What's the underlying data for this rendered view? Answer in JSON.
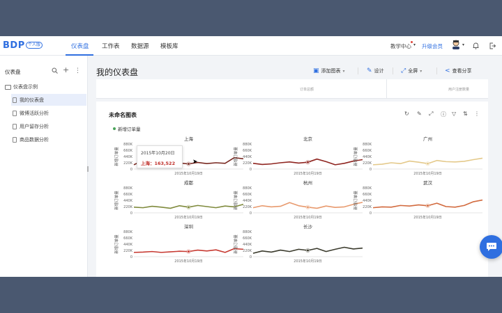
{
  "topbar": {
    "logo": "BDP",
    "logo_badge": "个人版",
    "tabs": [
      {
        "label": "仪表盘",
        "active": true
      },
      {
        "label": "工作表",
        "active": false
      },
      {
        "label": "数据源",
        "active": false
      },
      {
        "label": "模板库",
        "active": false
      }
    ],
    "teach_center": "教学中心",
    "upgrade": "升级会员"
  },
  "sidebar": {
    "title": "仪表盘",
    "root": "仪表盘示例",
    "items": [
      {
        "label": "我的仪表盘",
        "active": true
      },
      {
        "label": "微博活跃分析",
        "active": false
      },
      {
        "label": "用户留存分析",
        "active": false
      },
      {
        "label": "商品数据分析",
        "active": false
      }
    ]
  },
  "main": {
    "title": "我的仪表盘",
    "toolbar": {
      "add_chart": "添加图表",
      "design": "设计",
      "fullscreen": "全屏",
      "share": "查看分享"
    },
    "prev_card": {
      "left_text": "订单总额",
      "right_text": "用户注册数量"
    }
  },
  "card": {
    "title": "未命名图表",
    "legend": "新增订单量",
    "legend_color": "#4aa35a",
    "tooltip": {
      "date": "2015年10月20日",
      "value_line": "上海：163,522"
    }
  },
  "chart_data": {
    "type": "line",
    "title": "未命名图表",
    "ylabel": "新增订单量",
    "xlabel": "2015年10月19日",
    "yticks": [
      "880K",
      "660K",
      "440K",
      "220K",
      "0"
    ],
    "ylim": [
      0,
      880000
    ],
    "panels": [
      {
        "name": "上海",
        "color": "#7a2a22",
        "values": [
          150000,
          300000,
          200000,
          163522,
          240000,
          210000,
          180000,
          230000,
          190000,
          220000,
          200000,
          400000,
          360000
        ]
      },
      {
        "name": "北京",
        "color": "#8f2520",
        "values": [
          200000,
          160000,
          180000,
          220000,
          250000,
          210000,
          240000,
          350000,
          260000,
          150000,
          200000,
          280000,
          330000
        ]
      },
      {
        "name": "广州",
        "color": "#e4c98a",
        "values": [
          150000,
          170000,
          220000,
          190000,
          280000,
          240000,
          190000,
          300000,
          260000,
          250000,
          270000,
          330000,
          380000
        ]
      },
      {
        "name": "成都",
        "color": "#7f8a3c",
        "values": [
          200000,
          180000,
          230000,
          200000,
          160000,
          250000,
          200000,
          260000,
          220000,
          180000,
          240000,
          210000,
          300000
        ]
      },
      {
        "name": "杭州",
        "color": "#e89a6e",
        "values": [
          180000,
          250000,
          210000,
          230000,
          360000,
          250000,
          200000,
          160000,
          240000,
          190000,
          210000,
          300000,
          370000
        ]
      },
      {
        "name": "武汉",
        "color": "#d26a3e",
        "values": [
          180000,
          210000,
          200000,
          260000,
          240000,
          280000,
          250000,
          340000,
          220000,
          200000,
          260000,
          390000,
          450000
        ]
      },
      {
        "name": "深圳",
        "color": "#c73a32",
        "values": [
          150000,
          160000,
          180000,
          150000,
          170000,
          190000,
          180000,
          230000,
          200000,
          240000,
          150000,
          280000,
          260000
        ]
      },
      {
        "name": "长沙",
        "color": "#3a3a2c",
        "values": [
          120000,
          200000,
          160000,
          230000,
          180000,
          260000,
          220000,
          290000,
          180000,
          260000,
          330000,
          270000,
          300000
        ]
      }
    ]
  }
}
